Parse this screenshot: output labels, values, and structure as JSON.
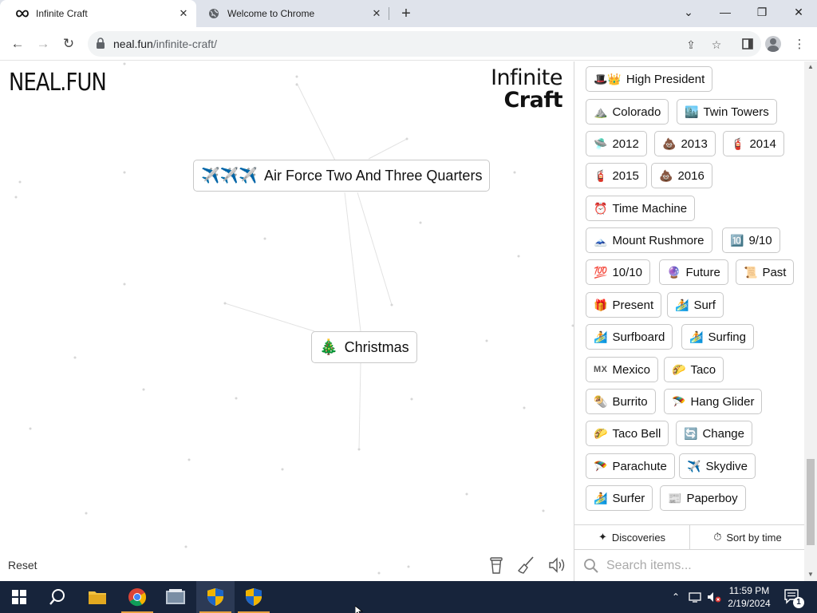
{
  "browser": {
    "tabs": [
      {
        "title": "Infinite Craft",
        "favicon": "infinity-icon",
        "active": true
      },
      {
        "title": "Welcome to Chrome",
        "favicon": "globe-icon",
        "active": false
      }
    ],
    "address": {
      "domain": "neal.fun",
      "path": "/infinite-craft/"
    }
  },
  "canvas": {
    "logo": "NEAL.FUN",
    "brand_line1": "Infinite",
    "brand_line2": "Craft",
    "elements": [
      {
        "emoji": "✈️✈️✈️",
        "label": "Air Force Two And Three Quarters"
      },
      {
        "emoji": "🎄",
        "label": "Christmas"
      }
    ],
    "reset_label": "Reset"
  },
  "sidebar": {
    "items": [
      {
        "emoji": "🎩👑",
        "label": "High President"
      },
      {
        "emoji": "⛰️",
        "label": "Colorado"
      },
      {
        "emoji": "🏙️",
        "label": "Twin Towers"
      },
      {
        "emoji": "🛸",
        "label": "2012"
      },
      {
        "emoji": "💩",
        "label": "2013"
      },
      {
        "emoji": "🧯",
        "label": "2014"
      },
      {
        "emoji": "🧯",
        "label": "2015"
      },
      {
        "emoji": "💩",
        "label": "2016"
      },
      {
        "emoji": "⏰",
        "label": "Time Machine"
      },
      {
        "emoji": "🗻",
        "label": "Mount Rushmore"
      },
      {
        "emoji": "🔟",
        "label": "9/10"
      },
      {
        "emoji": "💯",
        "label": "10/10"
      },
      {
        "emoji": "🔮",
        "label": "Future"
      },
      {
        "emoji": "📜",
        "label": "Past"
      },
      {
        "emoji": "🎁",
        "label": "Present"
      },
      {
        "emoji": "🏄",
        "label": "Surf"
      },
      {
        "emoji": "🏄",
        "label": "Surfboard"
      },
      {
        "emoji": "🏄",
        "label": "Surfing"
      },
      {
        "emoji": "MX",
        "label": "Mexico",
        "text_icon": true
      },
      {
        "emoji": "🌮",
        "label": "Taco"
      },
      {
        "emoji": "🌯",
        "label": "Burrito"
      },
      {
        "emoji": "🪂",
        "label": "Hang Glider"
      },
      {
        "emoji": "🌮",
        "label": "Taco Bell"
      },
      {
        "emoji": "🔄",
        "label": "Change"
      },
      {
        "emoji": "🪂",
        "label": "Parachute"
      },
      {
        "emoji": "✈️",
        "label": "Skydive"
      },
      {
        "emoji": "🏄",
        "label": "Surfer"
      },
      {
        "emoji": "📰",
        "label": "Paperboy"
      }
    ],
    "discoveries_label": "Discoveries",
    "sort_label": "Sort by time",
    "search_placeholder": "Search items..."
  },
  "taskbar": {
    "time": "11:59 PM",
    "date": "2/19/2024",
    "notification_count": "1"
  }
}
